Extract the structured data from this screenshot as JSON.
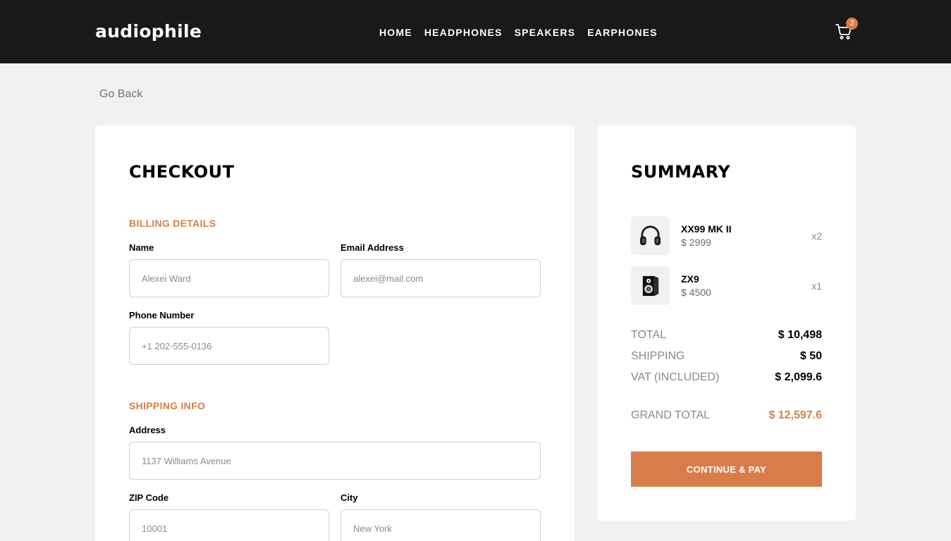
{
  "header": {
    "logo": "audiophile",
    "nav": [
      "HOME",
      "HEADPHONES",
      "SPEAKERS",
      "EARPHONES"
    ],
    "cart_count": "2"
  },
  "go_back": "Go Back",
  "checkout": {
    "title": "CHECKOUT",
    "billing": {
      "title": "BILLING DETAILS",
      "name_label": "Name",
      "name_placeholder": "Alexei Ward",
      "email_label": "Email Address",
      "email_placeholder": "alexei@mail.com",
      "phone_label": "Phone Number",
      "phone_placeholder": "+1 202-555-0136"
    },
    "shipping": {
      "title": "SHIPPING INFO",
      "address_label": "Address",
      "address_placeholder": "1137 Williams Avenue",
      "zip_label": "ZIP Code",
      "zip_placeholder": "10001",
      "city_label": "City",
      "city_placeholder": "New York"
    }
  },
  "summary": {
    "title": "SUMMARY",
    "items": [
      {
        "name": "XX99 MK II",
        "price": "$ 2999",
        "qty": "x2",
        "icon": "headphones-icon"
      },
      {
        "name": "ZX9",
        "price": "$ 4500",
        "qty": "x1",
        "icon": "speaker-icon"
      }
    ],
    "total_label": "TOTAL",
    "total_value": "$ 10,498",
    "shipping_label": "SHIPPING",
    "shipping_value": "$ 50",
    "vat_label": "VAT (INCLUDED)",
    "vat_value": "$ 2,099.6",
    "grand_label": "GRAND TOTAL",
    "grand_value": "$ 12,597.6",
    "pay_button": "CONTINUE & PAY"
  },
  "colors": {
    "accent": "#d87d4a",
    "header_bg": "#191919",
    "page_bg": "#f1f1f1"
  }
}
